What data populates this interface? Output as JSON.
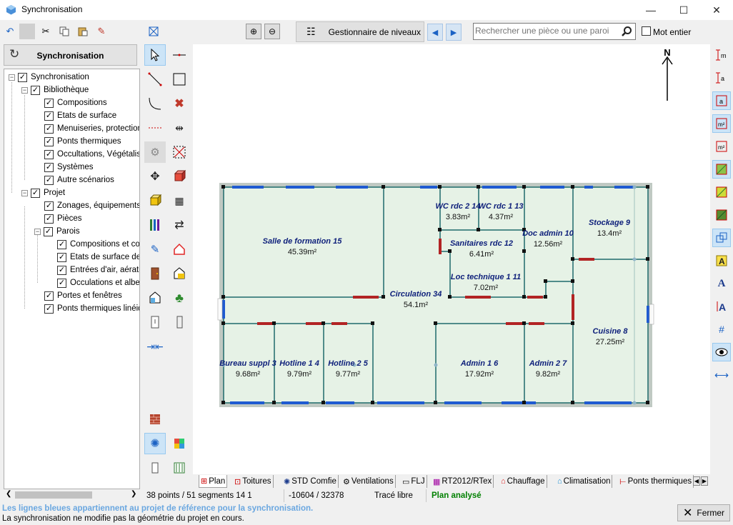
{
  "window": {
    "title": "Synchronisation",
    "minimize": "—",
    "maximize": "☐",
    "close": "✕"
  },
  "toolbar": {
    "sync_label": "Synchronisation",
    "levels_label": "Gestionnaire de niveaux",
    "search_placeholder": "Rechercher une pièce ou une paroi",
    "whole_word_label": "Mot entier"
  },
  "tree": {
    "root": "Synchronisation",
    "bibliotheque": "Bibliothèque",
    "compositions": "Compositions",
    "etats_surface": "Etats de surface",
    "menuiseries": "Menuiseries, protections",
    "ponts": "Ponts thermiques",
    "occultations": "Occultations, Végétalisat",
    "systemes": "Systèmes",
    "autres": "Autre scénarios",
    "projet": "Projet",
    "zonages": "Zonages, équipements e",
    "pieces": "Pièces",
    "parois": "Parois",
    "p_compositions": "Compositions et con",
    "p_etats": "Etats de surface de",
    "p_entrees": "Entrées d'air, aératic",
    "p_occultations": "Occulations et albec",
    "portes": "Portes et fenêtres",
    "p_ponts": "Ponts thermiques linéiqu"
  },
  "plan": {
    "north": "N",
    "rooms": [
      {
        "name": "Salle de formation 15",
        "area": "45.39m²"
      },
      {
        "name": "WC rdc 2 14",
        "area": "3.83m²"
      },
      {
        "name": "WC rdc 1 13",
        "area": "4.37m²"
      },
      {
        "name": "Doc admin 10",
        "area": "12.56m²"
      },
      {
        "name": "Stockage 9",
        "area": "13.4m²"
      },
      {
        "name": "Sanitaires rdc 12",
        "area": "6.41m²"
      },
      {
        "name": "Loc technique 1 11",
        "area": "7.02m²"
      },
      {
        "name": "Circulation 34",
        "area": "54.1m²"
      },
      {
        "name": "Cuisine 8",
        "area": "27.25m²"
      },
      {
        "name": "Bureau suppl 3",
        "area": "9.68m²"
      },
      {
        "name": "Hotline 1 4",
        "area": "9.79m²"
      },
      {
        "name": "Hotline 2 5",
        "area": "9.77m²"
      },
      {
        "name": "Admin 1 6",
        "area": "17.92m²"
      },
      {
        "name": "Admin 2 7",
        "area": "9.82m²"
      }
    ]
  },
  "tabs": [
    "Plan",
    "Toitures",
    "STD Comfie",
    "Ventilations",
    "FLJ",
    "RT2012/RTex",
    "Chauffage",
    "Climatisation",
    "Ponts thermiques"
  ],
  "status": {
    "points": "38 points / 51 segments 14 1",
    "coords": "-10604 / 32378",
    "mode": "Tracé libre",
    "analysis": "Plan analysé"
  },
  "footer": {
    "info_blue": "Les lignes bleues appartiennent au projet de référence pour la synchronisation.",
    "info": "La synchronisation ne modifie pas la géométrie du projet en cours.",
    "close_label": "Fermer"
  },
  "colors": {
    "accent": "#1b62c4",
    "room_fill": "#e6f2e6",
    "room_label": "#0d1f7a",
    "analysis": "#008000",
    "info_blue": "#6aa7e0"
  }
}
